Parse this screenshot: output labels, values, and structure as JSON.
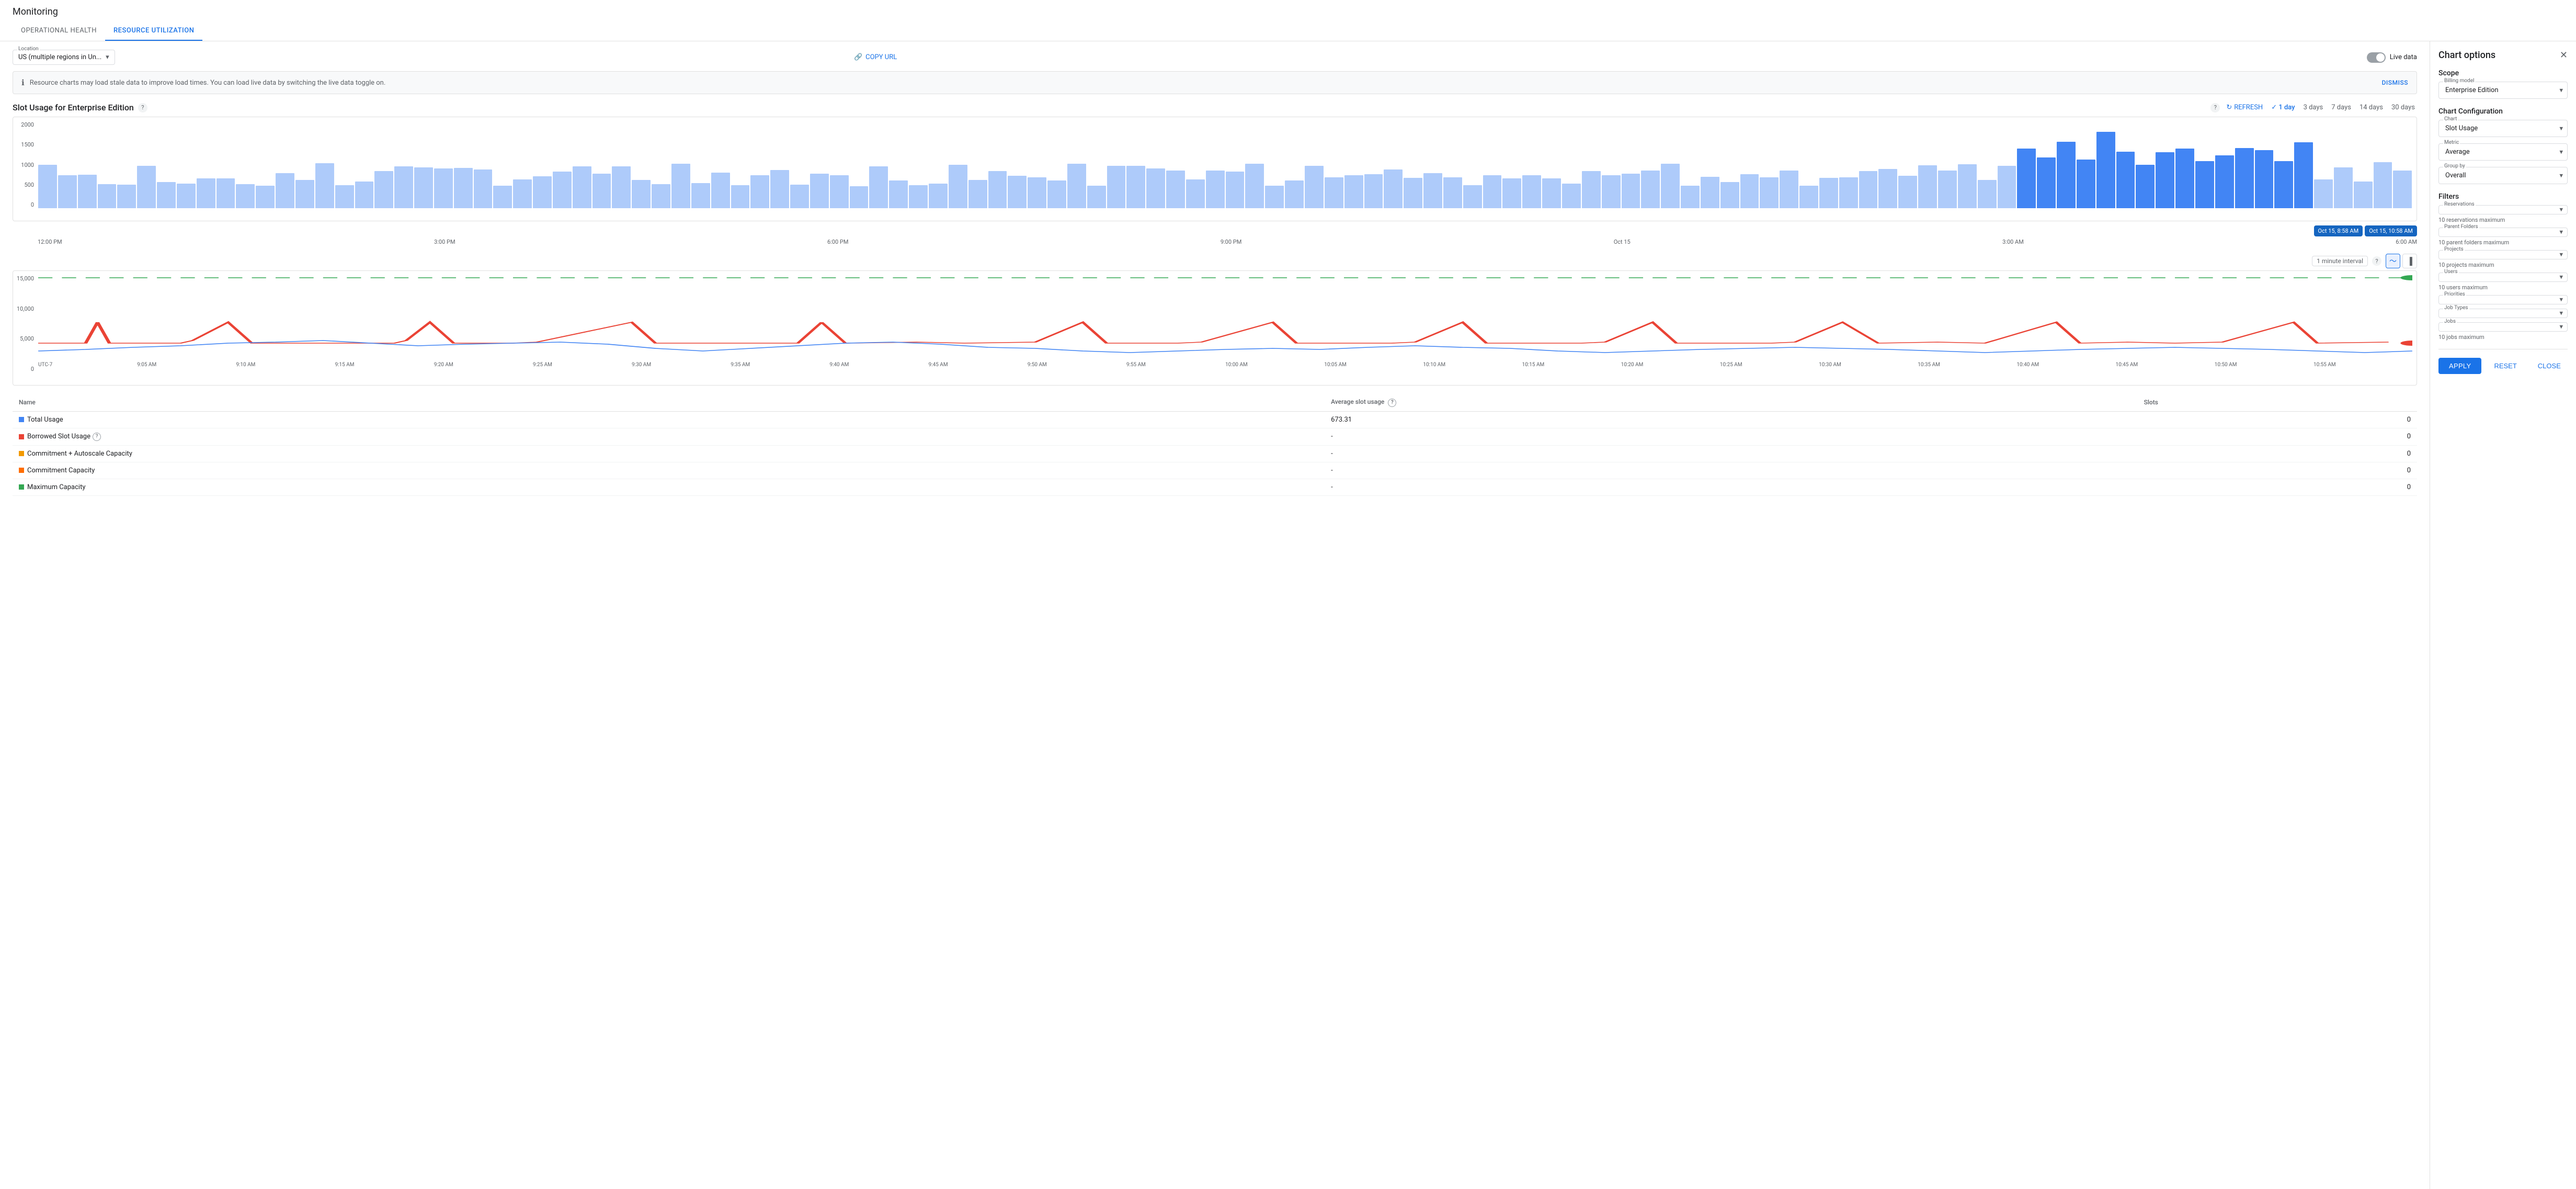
{
  "app": {
    "title": "Monitoring"
  },
  "tabs": [
    {
      "id": "operational-health",
      "label": "Operational Health",
      "active": false
    },
    {
      "id": "resource-utilization",
      "label": "Resource Utilization",
      "active": true
    }
  ],
  "topControls": {
    "locationLabel": "Location",
    "locationValue": "US (multiple regions in Un...",
    "copyUrlLabel": "COPY URL",
    "liveDataLabel": "Live data"
  },
  "infoBanner": {
    "text": "Resource charts may load stale data to improve load times. You can load live data by switching the live data toggle on.",
    "dismissLabel": "DISMISS"
  },
  "chart": {
    "title": "Slot Usage for Enterprise Edition",
    "refreshLabel": "REFRESH",
    "dayButtons": [
      {
        "label": "1 day",
        "active": true
      },
      {
        "label": "3 days",
        "active": false
      },
      {
        "label": "7 days",
        "active": false
      },
      {
        "label": "14 days",
        "active": false
      },
      {
        "label": "30 days",
        "active": false
      }
    ],
    "yLabels": [
      "2000",
      "1500",
      "1000",
      "500",
      "0"
    ],
    "xLabels": [
      "12:00 PM",
      "3:00 PM",
      "6:00 PM",
      "9:00 PM",
      "Oct 15",
      "3:00 AM",
      "6:00 AM"
    ],
    "tooltip1": "Oct 15, 8:58 AM",
    "tooltip2": "Oct 15, 10:58 AM",
    "intervalLabel": "1 minute interval",
    "refValue": "15,000",
    "lineXLabels": [
      "UTC-7",
      "9:05 AM",
      "9:10 AM",
      "9:15 AM",
      "9:20 AM",
      "9:25 AM",
      "9:30 AM",
      "9:35 AM",
      "9:40 AM",
      "9:45 AM",
      "9:50 AM",
      "9:55 AM",
      "10:00 AM",
      "10:05 AM",
      "10:10 AM",
      "10:15 AM",
      "10:20 AM",
      "10:25 AM",
      "10:30 AM",
      "10:35 AM",
      "10:40 AM",
      "10:45 AM",
      "10:50 AM",
      "10:55 AM"
    ]
  },
  "table": {
    "columns": [
      "Name",
      "Average slot usage",
      "Slots"
    ],
    "rows": [
      {
        "name": "Total Usage",
        "color": "#4285f4",
        "shape": "square",
        "avgSlot": "673.31",
        "slots": "0",
        "hasInfo": false
      },
      {
        "name": "Borrowed Slot Usage",
        "color": "#ea4335",
        "shape": "square",
        "avgSlot": "-",
        "slots": "0",
        "hasInfo": true
      },
      {
        "name": "Commitment + Autoscale Capacity",
        "color": "#f29900",
        "shape": "square",
        "avgSlot": "-",
        "slots": "0",
        "hasInfo": false
      },
      {
        "name": "Commitment Capacity",
        "color": "#ff6d00",
        "shape": "square",
        "avgSlot": "-",
        "slots": "0",
        "hasInfo": false
      },
      {
        "name": "Maximum Capacity",
        "color": "#34a853",
        "shape": "square",
        "avgSlot": "-",
        "slots": "0",
        "hasInfo": false
      }
    ]
  },
  "sidePanel": {
    "title": "Chart options",
    "scope": {
      "sectionLabel": "Scope",
      "billingModelLabel": "Billing model",
      "billingModelValue": "Enterprise Edition"
    },
    "chartConfig": {
      "sectionLabel": "Chart Configuration",
      "chartLabel": "Chart",
      "chartValue": "Slot Usage",
      "metricLabel": "Metric",
      "metricValue": "Average",
      "groupByLabel": "Group by",
      "groupByValue": "Overall"
    },
    "filters": {
      "sectionLabel": "Filters",
      "reservationsLabel": "Reservations",
      "reservationsHint": "10 reservations maximum",
      "parentFoldersLabel": "Parent Folders",
      "parentFoldersHint": "10 parent folders maximum",
      "projectsLabel": "Projects",
      "projectsHint": "10 projects maximum",
      "usersLabel": "Users",
      "usersHint": "10 users maximum",
      "prioritiesLabel": "Priorities",
      "jobTypesLabel": "Job Types",
      "jobsLabel": "Jobs",
      "jobsHint": "10 jobs maximum"
    },
    "footer": {
      "applyLabel": "APPLY",
      "resetLabel": "RESET",
      "closeLabel": "CLOSE"
    }
  }
}
